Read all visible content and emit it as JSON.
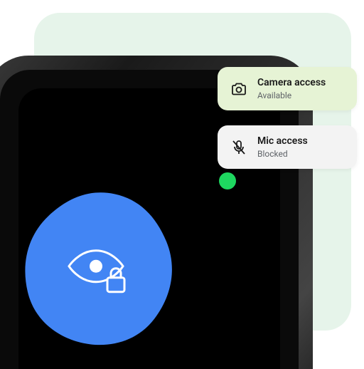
{
  "chips": {
    "camera": {
      "title": "Camera access",
      "subtitle": "Available"
    },
    "mic": {
      "title": "Mic access",
      "subtitle": "Blocked"
    }
  },
  "colors": {
    "mint": "#e6f4ea",
    "camera_chip": "#e6f3d5",
    "mic_chip": "#f3f3f3",
    "blue": "#4285f4",
    "indicator": "#1ed760"
  }
}
